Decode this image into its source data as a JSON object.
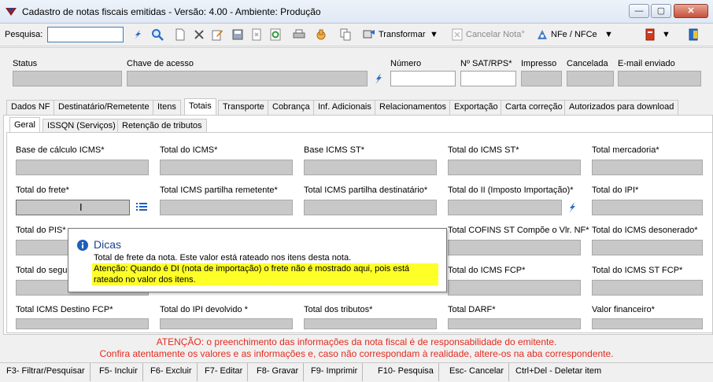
{
  "window": {
    "title": "Cadastro de notas fiscais emitidas - Versão: 4.00 - Ambiente: Produção",
    "minimize": "—",
    "maximize": "▢",
    "close": "✕"
  },
  "toolbar": {
    "search_label": "Pesquisa:",
    "search_value": "",
    "transformar_label": "Transformar",
    "cancelar_nota_label": "Cancelar Nota°",
    "nfe_nfce_label": "NFe / NFCe",
    "icons": [
      "flash-search-icon",
      "magnifier-icon",
      "new-document-icon",
      "delete-x-icon",
      "edit-pencil-icon",
      "save-icon",
      "cancel-document-icon",
      "refresh-icon",
      "print-icon",
      "hand-icon",
      "copy-icon",
      "transform-icon",
      "cancel-note-icon",
      "nfe-icon",
      "book-icon",
      "exit-door-icon"
    ]
  },
  "header": {
    "status_label": "Status",
    "chave_label": "Chave de acesso",
    "numero_label": "Número",
    "sat_label": "Nº SAT/RPS*",
    "impresso_label": "Impresso",
    "cancelada_label": "Cancelada",
    "email_label": "E-mail enviado"
  },
  "main_tabs": [
    "Dados NF",
    "Destinatário/Remetente",
    "Itens",
    "Totais",
    "Transporte",
    "Cobrança",
    "Inf. Adicionais",
    "Relacionamentos",
    "Exportação",
    "Carta correção",
    "Autorizados para download"
  ],
  "main_tab_active": "Totais",
  "sub_tabs": [
    "Geral",
    "ISSQN (Serviços)",
    "Retenção de tributos"
  ],
  "sub_tab_active": "Geral",
  "fields": {
    "row1": [
      "Base de cálculo ICMS*",
      "Total do ICMS*",
      "Base ICMS ST*",
      "Total do ICMS ST*",
      "Total mercadoria*"
    ],
    "row2": [
      "Total do frete*",
      "Total ICMS partilha remetente*",
      "Total ICMS partilha destinatário*",
      "Total do II (Imposto Importação)*",
      "Total do IPI*"
    ],
    "row3": [
      "Total do PIS*",
      "Total COFINS ST Compõe o Vlr. NF*",
      "Total do ICMS desonerado*"
    ],
    "row4": [
      "Total do segu",
      "Total do ICMS FCP*",
      "Total do ICMS ST FCP*"
    ],
    "row5": [
      "Total ICMS Destino FCP*",
      "Total do IPI devolvido *",
      "Total dos tributos*",
      "Total DARF*",
      "Valor financeiro*"
    ]
  },
  "tooltip": {
    "title": "Dicas",
    "text": "Total de frete da nota. Este valor está rateado nos itens desta nota.",
    "warning_line1": "Atenção: Quando é DI (nota de importação) o frete não é mostrado aqui, pois está",
    "warning_line2": "rateado no valor dos itens."
  },
  "warning": {
    "line1": "ATENÇÃO: o preenchimento das informações da nota fiscal é de responsabilidade do emitente.",
    "line2": "Confira atentamente os valores e as informações e, caso não correspondam à realidade, altere-os na aba correspondente."
  },
  "statusbar": [
    "F3- Filtrar/Pesquisar",
    "F5- Incluir",
    "F6- Excluir",
    "F7- Editar",
    "F8- Gravar",
    "F9- Imprimir",
    "F10- Pesquisa",
    "Esc- Cancelar",
    "Ctrl+Del - Deletar item"
  ],
  "colors": {
    "warning_red": "#e42a1e",
    "tooltip_highlight": "#ffff28",
    "field_gray": "#c8c8c8"
  }
}
